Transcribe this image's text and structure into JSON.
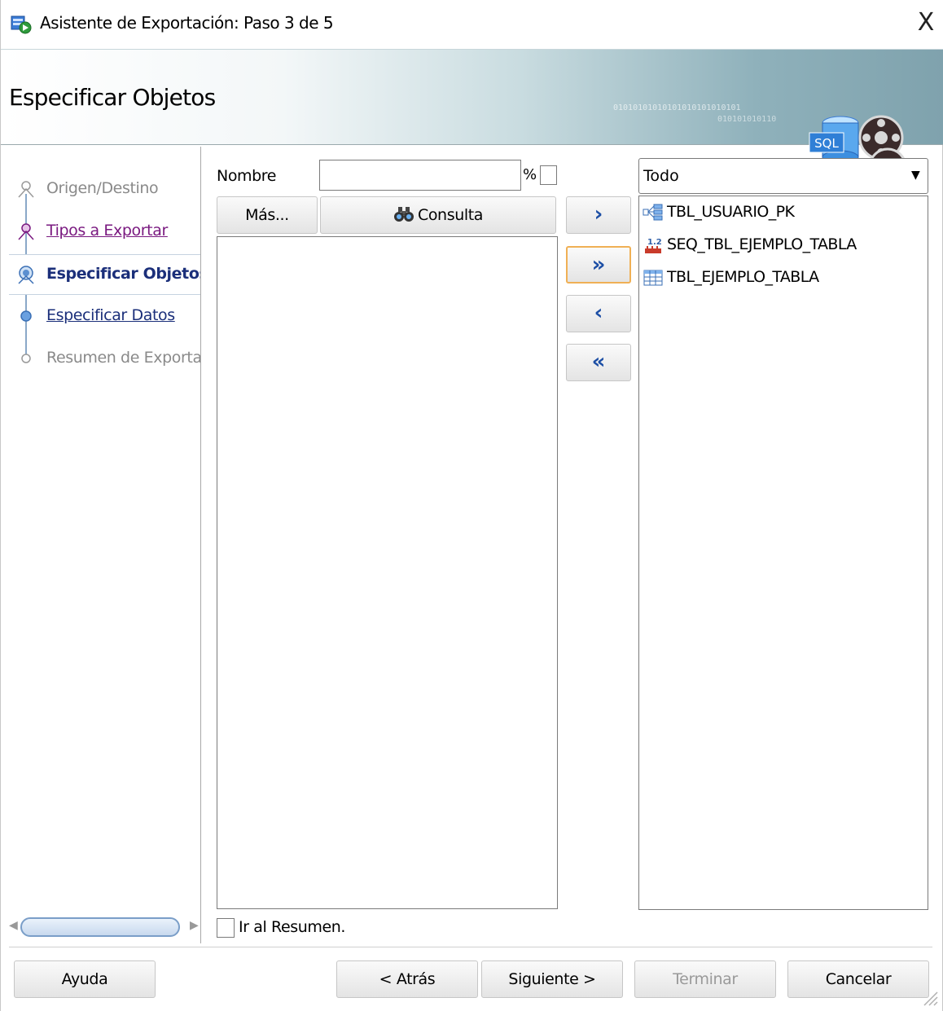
{
  "window": {
    "title": "Asistente de Exportación: Paso 3 de 5",
    "close_glyph": "X"
  },
  "banner": {
    "title": "Especificar Objetos",
    "binary_line1": "01010101010101010101010101",
    "binary_line2": "010101010110",
    "graphic_label": "SQL"
  },
  "nav": {
    "steps": [
      {
        "label": "Origen/Destino",
        "state": "disabled"
      },
      {
        "label": "Tipos a Exportar",
        "state": "visited"
      },
      {
        "label": "Especificar Objetos",
        "state": "current"
      },
      {
        "label": "Especificar Datos",
        "state": "link"
      },
      {
        "label": "Resumen de Exportación",
        "state": "disabled"
      }
    ]
  },
  "filter": {
    "name_label": "Nombre",
    "name_value": "",
    "percent_label": "%",
    "percent_checked": false,
    "more_button": "Más...",
    "query_button": "Consulta"
  },
  "move_buttons": {
    "add_one": "›",
    "add_all": "»",
    "remove_one": "‹",
    "remove_all": "«"
  },
  "available_list": [],
  "selected": {
    "type_filter": "Todo",
    "items": [
      {
        "name": "TBL_USUARIO_PK",
        "icon": "index-icon"
      },
      {
        "name": "SEQ_TBL_EJEMPLO_TABLA",
        "icon": "sequence-icon"
      },
      {
        "name": "TBL_EJEMPLO_TABLA",
        "icon": "table-icon"
      }
    ]
  },
  "go_to_summary": {
    "label": "Ir al Resumen.",
    "checked": false
  },
  "footer": {
    "help": "Ayuda",
    "back": "< Atrás",
    "next": "Siguiente >",
    "finish": "Terminar",
    "cancel": "Cancelar"
  },
  "colors": {
    "current_step": "#1b2f7a",
    "visited_step": "#7a1a80",
    "disabled_text": "#8a8a8a",
    "move_arrow": "#1d4fa5",
    "focus_border": "#f0b055"
  }
}
